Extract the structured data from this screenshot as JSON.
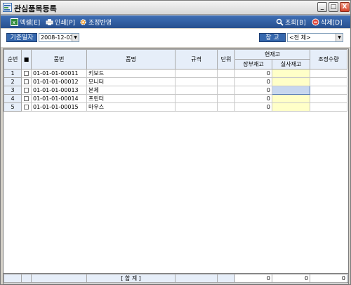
{
  "window": {
    "title": "관심품목등록",
    "min": "_",
    "max": "□",
    "close": "X"
  },
  "toolbar": {
    "excel": "엑셀[E]",
    "print": "인쇄[P]",
    "adjust": "조정반영",
    "search": "조회[B]",
    "delete": "삭제[D]"
  },
  "filter": {
    "date_label": "기준일자",
    "date_value": "2008-12-03",
    "warehouse_label": "창 고",
    "warehouse_value": "<전 체>"
  },
  "grid": {
    "headers": {
      "seq": "순번",
      "check": "■",
      "code": "품번",
      "name": "품명",
      "spec": "규격",
      "unit": "단위",
      "stock_group": "현재고",
      "book_stock": "장부재고",
      "actual_stock": "실사재고",
      "adjust_qty": "조정수량"
    },
    "rows": [
      {
        "seq": "1",
        "code": "01-01-01-00011",
        "name": "키보드",
        "book": "0"
      },
      {
        "seq": "2",
        "code": "01-01-01-00012",
        "name": "모니터",
        "book": "0"
      },
      {
        "seq": "3",
        "code": "01-01-01-00013",
        "name": "본체",
        "book": "0"
      },
      {
        "seq": "4",
        "code": "01-01-01-00014",
        "name": "프린터",
        "book": "0"
      },
      {
        "seq": "5",
        "code": "01-01-01-00015",
        "name": "마우스",
        "book": "0"
      }
    ]
  },
  "footer": {
    "label": "[ 합 계 ]",
    "book_total": "0",
    "actual_total": "0",
    "adjust_total": "0"
  },
  "colors": {
    "toolbar": "#2f5d9f",
    "header": "#e6eef9",
    "highlight": "#ffffc8"
  }
}
